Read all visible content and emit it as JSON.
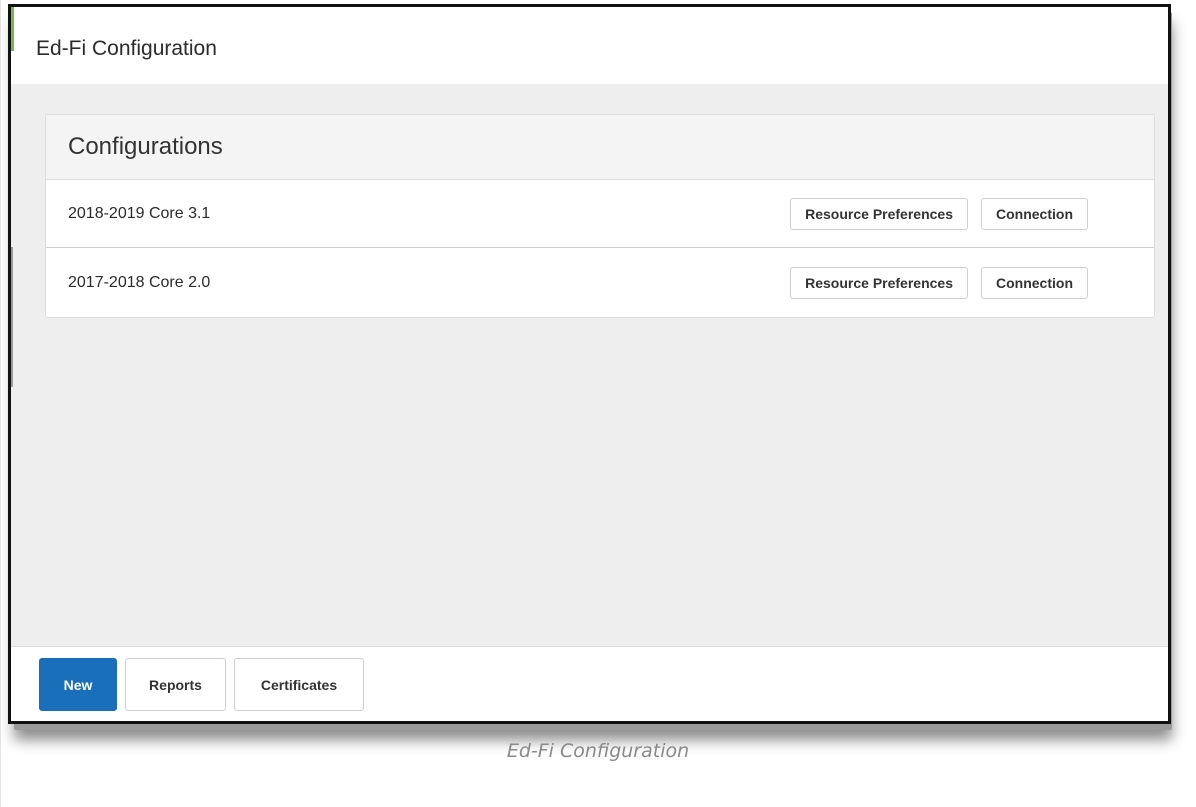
{
  "header": {
    "title": "Ed-Fi Configuration"
  },
  "card": {
    "title": "Configurations"
  },
  "configurations": [
    {
      "name": "2018-2019 Core 3.1",
      "resource_preferences_label": "Resource Preferences",
      "connection_label": "Connection"
    },
    {
      "name": "2017-2018 Core 2.0",
      "resource_preferences_label": "Resource Preferences",
      "connection_label": "Connection"
    }
  ],
  "footer": {
    "new_label": "New",
    "reports_label": "Reports",
    "certificates_label": "Certificates"
  },
  "caption": "Ed-Fi Configuration",
  "colors": {
    "primary": "#1a6fba",
    "accent": "#7ab648"
  }
}
